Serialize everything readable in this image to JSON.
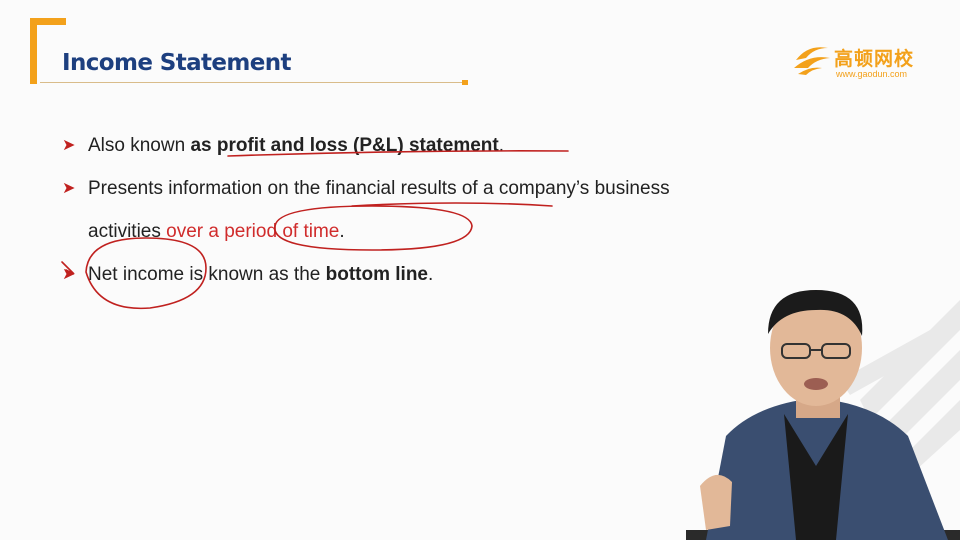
{
  "header": {
    "title": "Income Statement"
  },
  "logo": {
    "name_cn": "高顿网校",
    "url": "www.gaodun.com"
  },
  "bullets": [
    {
      "segments": [
        {
          "text": "Also known ",
          "bold": false
        },
        {
          "text": "as profit and loss (P&L) statement",
          "bold": true
        },
        {
          "text": ".",
          "bold": false
        }
      ]
    },
    {
      "segments": [
        {
          "text": "Presents information on the financial results of a company’s business activities ",
          "bold": false
        },
        {
          "text": "over a period of time",
          "red": true
        },
        {
          "text": ".",
          "bold": false
        }
      ]
    },
    {
      "segments": [
        {
          "text": "Net income is known as the ",
          "bold": false
        },
        {
          "text": "bottom line",
          "bold": true
        },
        {
          "text": ".",
          "bold": false
        }
      ]
    }
  ],
  "colors": {
    "accent": "#f3a11b",
    "title": "#1d3f7f",
    "ink": "#c0211f",
    "bullet_arrow": "#c0211f"
  },
  "icons": {
    "bullet": "arrowhead-bullet-icon",
    "logo": "gaodun-logo-icon"
  }
}
